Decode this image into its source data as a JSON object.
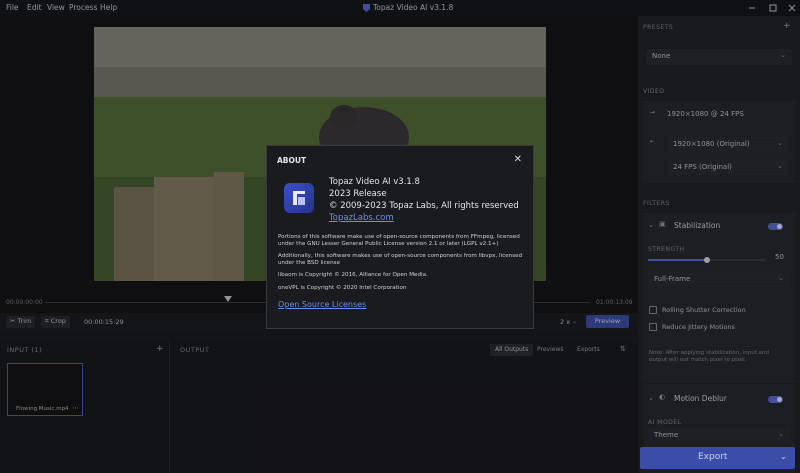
{
  "titlebar": {
    "menu": [
      "File",
      "Edit",
      "View",
      "Process",
      "Help"
    ],
    "title": "Topaz Video AI  v3.1.8"
  },
  "viewer": {
    "time_start": "00:00:00:00",
    "time_end": "01:00:13:09"
  },
  "controls": {
    "trim_label": "Trim",
    "crop_label": "Crop",
    "timecode": "00:00:15:29",
    "zoom": "2 x",
    "preview_label": "Preview"
  },
  "input_panel": {
    "title": "INPUT (1)",
    "thumb_label": "Flowing Music.mp4"
  },
  "output_panel": {
    "title": "OUTPUT",
    "tabs": [
      "All Outputs",
      "Previews",
      "Exports"
    ]
  },
  "right_panel": {
    "presets_label": "PRESETS",
    "preset_value": "None",
    "video_label": "VIDEO",
    "resolution_text": "1920×1080 @ 24 FPS",
    "resolution_select": "1920×1080 (Original)",
    "fps_select": "24 FPS (Original)",
    "filters_label": "FILTERS",
    "stabilization_label": "Stabilization",
    "strength_label": "STRENGTH",
    "strength_value": "50",
    "strength_fraction": 0.5,
    "mode_select": "Full-Frame",
    "rolling_shutter_label": "Rolling Shutter Correction",
    "jittery_label": "Reduce Jittery Motions",
    "note": "Note: After applying stabilization, input and output will not match pixel to pixel.",
    "motion_deblur_label": "Motion Deblur",
    "ai_model_label": "AI MODEL",
    "ai_model_value": "Theme"
  },
  "about": {
    "header": "ABOUT",
    "line1": "Topaz Video AI  v3.1.8",
    "line2": "2023 Release",
    "line3": "© 2009-2023 Topaz Labs, All rights reserved",
    "link": "TopazLabs.com",
    "p1": "Portions of this software make use of open-source components from FFmpeg, licensed under the GNU Lesser General Public License version 2.1 or later (LGPL v2.1+)",
    "p2": "Additionally, this software makes use of open-source components from libvpx, licensed under the BSD license",
    "p3": "libaom is Copyright © 2016, Alliance for Open Media.",
    "p4": "oneVPL is Copyright © 2020 Intel Corporation",
    "license_link": "Open Source Licenses"
  },
  "export": {
    "label": "Export"
  },
  "colors": {
    "accent": "#3b4da8",
    "link": "#6a8ff0",
    "background": "#1c1d22"
  }
}
